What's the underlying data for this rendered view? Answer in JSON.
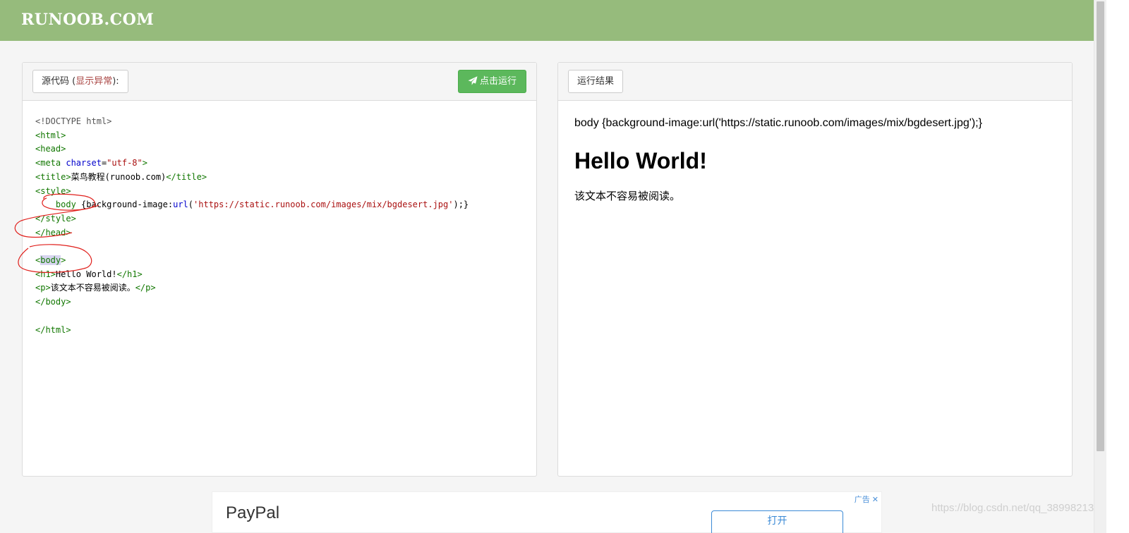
{
  "header": {
    "logo": "RUNOOB.COM"
  },
  "source_panel": {
    "label_prefix": "源代码 (",
    "label_error": "显示异常",
    "label_suffix": "):",
    "run_button": "点击运行",
    "code": {
      "doctype": "<!DOCTYPE html>",
      "html_open": "<html>",
      "head_open": "<head>",
      "meta_tag_open": "<meta ",
      "meta_attr": "charset",
      "meta_eq": "=",
      "meta_val": "\"utf-8\"",
      "meta_tag_close": ">",
      "title_open": "<title>",
      "title_text": "菜鸟教程(runoob.com)",
      "title_close": "</title>",
      "style_open": "<style>",
      "indent": "    ",
      "css_selector": "body",
      "css_decl_start": " {background-image:",
      "css_func": "url",
      "css_paren_open": "(",
      "css_str": "'https://static.runoob.com/images/mix/bgdesert.jpg'",
      "css_decl_end": ");}",
      "style_close": "</style>",
      "head_close": "</head>",
      "body_lt": "<",
      "body_name": "body",
      "body_gt": ">",
      "h1_open": "<h1>",
      "h1_text": "Hello World!",
      "h1_close": "</h1>",
      "p_open": "<p>",
      "p_text": "该文本不容易被阅读。",
      "p_close": "</p>",
      "body_close": "</body>",
      "html_close": "</html>"
    }
  },
  "result_panel": {
    "label": "运行结果",
    "text_line": "body {background-image:url('https://static.runoob.com/images/mix/bgdesert.jpg');}",
    "heading": "Hello World!",
    "paragraph": "该文本不容易被阅读。"
  },
  "ad": {
    "brand": "PayPal",
    "label": "广告",
    "close": "✕",
    "button": "打开"
  },
  "watermark": "https://blog.csdn.net/qq_38998213",
  "colors": {
    "header_bg": "#96bb7c",
    "run_button": "#5cb85c",
    "code_tag": "#117700",
    "code_attr": "#0000cc",
    "code_string": "#aa1111",
    "annotation": "#e0201c"
  }
}
